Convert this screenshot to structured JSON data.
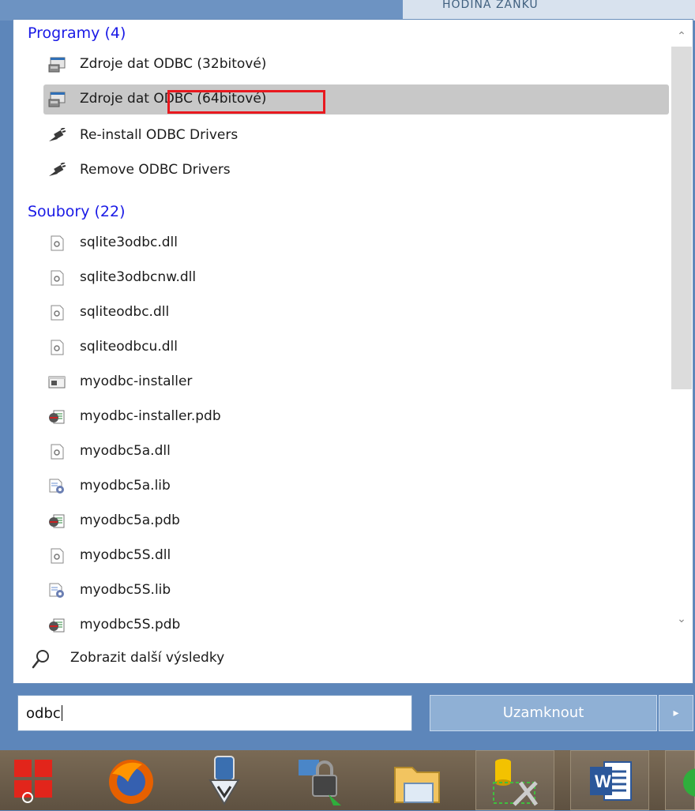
{
  "background_window": {
    "text": "HODINA ZÁNKU"
  },
  "programs": {
    "title": "Programy (4)",
    "items": [
      {
        "label": "Zdroje dat ODBC (32bitové)",
        "icon": "odbc-datasource-icon",
        "selected": false
      },
      {
        "label": "Zdroje dat ODBC (64bitové)",
        "icon": "odbc-datasource-icon",
        "selected": true
      },
      {
        "label": "Re-install ODBC Drivers",
        "icon": "driver-plug-icon",
        "selected": false
      },
      {
        "label": "Remove ODBC Drivers",
        "icon": "driver-plug-icon",
        "selected": false
      }
    ]
  },
  "files": {
    "title": "Soubory (22)",
    "items": [
      {
        "label": "sqlite3odbc.dll",
        "icon": "dll-file-icon"
      },
      {
        "label": "sqlite3odbcnw.dll",
        "icon": "dll-file-icon"
      },
      {
        "label": "sqliteodbc.dll",
        "icon": "dll-file-icon"
      },
      {
        "label": "sqliteodbcu.dll",
        "icon": "dll-file-icon"
      },
      {
        "label": "myodbc-installer",
        "icon": "exe-file-icon"
      },
      {
        "label": "myodbc-installer.pdb",
        "icon": "pdb-file-icon"
      },
      {
        "label": "myodbc5a.dll",
        "icon": "dll-file-icon"
      },
      {
        "label": "myodbc5a.lib",
        "icon": "lib-file-icon"
      },
      {
        "label": "myodbc5a.pdb",
        "icon": "pdb-file-icon"
      },
      {
        "label": "myodbc5S.dll",
        "icon": "dll-file-icon"
      },
      {
        "label": "myodbc5S.lib",
        "icon": "lib-file-icon"
      },
      {
        "label": "myodbc5S.pdb",
        "icon": "pdb-file-icon"
      }
    ]
  },
  "more_results": {
    "label": "Zobrazit další výsledky",
    "icon": "search-icon"
  },
  "search": {
    "value": "odbc"
  },
  "lock_button": {
    "label": "Uzamknout",
    "arrow": "▸"
  },
  "scroll": {
    "up": "⌃",
    "down": "⌄"
  },
  "colors": {
    "group_title": "#1a1ae6",
    "selection": "#c8c8c8",
    "highlight_box": "#e8191f",
    "lock_button": "#8fb0d5"
  },
  "taskbar": {
    "items": [
      {
        "icon": "start-windows-icon"
      },
      {
        "icon": "firefox-icon"
      },
      {
        "icon": "download-shield-icon"
      },
      {
        "icon": "network-lock-icon"
      },
      {
        "icon": "file-explorer-icon"
      },
      {
        "icon": "database-tools-icon"
      },
      {
        "icon": "word-icon",
        "label": "W"
      },
      {
        "icon": "app-icon"
      }
    ]
  }
}
